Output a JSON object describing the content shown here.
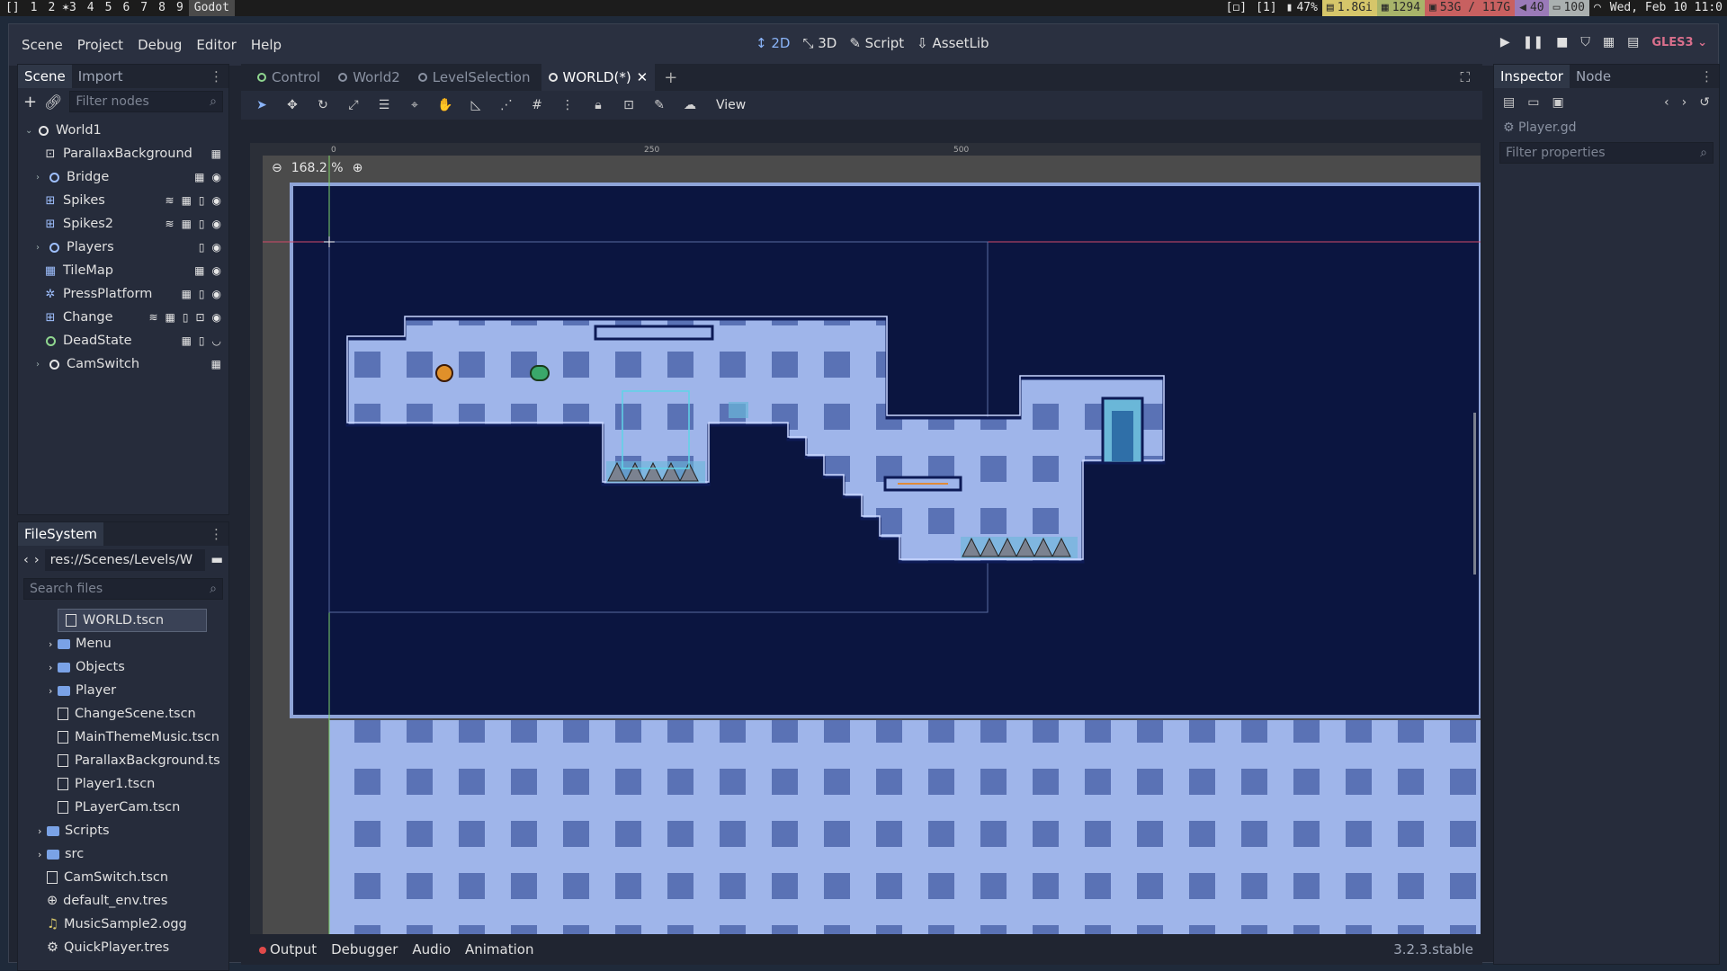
{
  "statusbar": {
    "workspaces": [
      "[]",
      "1",
      "2 ✶3",
      "4",
      "5",
      "6",
      "7",
      "8",
      "9",
      "Godot"
    ],
    "items": [
      "[◻]",
      "[1]",
      "47%",
      "1.8Gi",
      "1294",
      "53G / 117G",
      "40",
      "100",
      "Wed, Feb 10 11:0"
    ]
  },
  "menubar": {
    "menus": [
      "Scene",
      "Project",
      "Debug",
      "Editor",
      "Help"
    ],
    "modes": [
      "2D",
      "3D",
      "Script",
      "AssetLib"
    ],
    "renderer": "GLES3"
  },
  "scene_dock": {
    "tabs": [
      "Scene",
      "Import"
    ],
    "filter_placeholder": "Filter nodes",
    "nodes": [
      {
        "label": "World1"
      },
      {
        "label": "ParallaxBackground"
      },
      {
        "label": "Bridge"
      },
      {
        "label": "Spikes"
      },
      {
        "label": "Spikes2"
      },
      {
        "label": "Players"
      },
      {
        "label": "TileMap"
      },
      {
        "label": "PressPlatform"
      },
      {
        "label": "Change"
      },
      {
        "label": "DeadState"
      },
      {
        "label": "CamSwitch"
      }
    ]
  },
  "filesystem": {
    "title": "FileSystem",
    "path": "res://Scenes/Levels/W",
    "search_placeholder": "Search files",
    "items": [
      {
        "label": "WORLD.tscn"
      },
      {
        "label": "Menu"
      },
      {
        "label": "Objects"
      },
      {
        "label": "Player"
      },
      {
        "label": "ChangeScene.tscn"
      },
      {
        "label": "MainThemeMusic.tscn"
      },
      {
        "label": "ParallaxBackground.ts"
      },
      {
        "label": "Player1.tscn"
      },
      {
        "label": "PLayerCam.tscn"
      },
      {
        "label": "Scripts"
      },
      {
        "label": "src"
      },
      {
        "label": "CamSwitch.tscn"
      },
      {
        "label": "default_env.tres"
      },
      {
        "label": "MusicSample2.ogg"
      },
      {
        "label": "QuickPlayer.tres"
      }
    ]
  },
  "scene_tabs": [
    "Control",
    "World2",
    "LevelSelection",
    "WORLD(*)"
  ],
  "editor": {
    "view_label": "View",
    "zoom": "168.2 %",
    "ruler_marks": [
      "0",
      "250",
      "500"
    ]
  },
  "bottom": {
    "tabs": [
      "Output",
      "Debugger",
      "Audio",
      "Animation"
    ],
    "version": "3.2.3.stable"
  },
  "inspector": {
    "tabs": [
      "Inspector",
      "Node"
    ],
    "file": "Player.gd",
    "filter_placeholder": "Filter properties"
  },
  "colors": {
    "accent": "#8ab4f8",
    "background_level": "#0b1540",
    "tile_light": "#9fb5ea",
    "tile_dark": "#5a72b5",
    "gles": "#d96f8c"
  }
}
